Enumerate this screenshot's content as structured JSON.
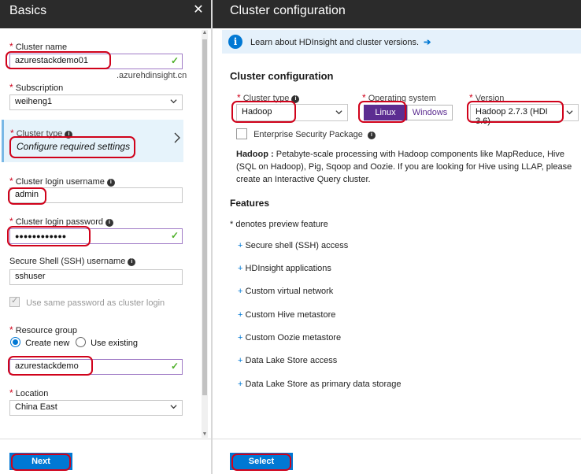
{
  "left": {
    "title": "Basics",
    "cluster_name": {
      "label": "Cluster name",
      "value": "azurestackdemo01",
      "suffix": ".azurehdinsight.cn"
    },
    "subscription": {
      "label": "Subscription",
      "value": "weiheng1"
    },
    "cluster_type": {
      "label": "Cluster type",
      "value": "Configure required settings"
    },
    "login_username": {
      "label": "Cluster login username",
      "value": "admin"
    },
    "login_password": {
      "label": "Cluster login password",
      "value": "●●●●●●●●●●●●"
    },
    "ssh_username": {
      "label": "Secure Shell (SSH) username",
      "value": "sshuser"
    },
    "same_password_label": "Use same password as cluster login",
    "resource_group": {
      "label": "Resource group",
      "create_new": "Create new",
      "use_existing": "Use existing",
      "value": "azurestackdemo"
    },
    "location": {
      "label": "Location",
      "value": "China East"
    },
    "next_label": "Next"
  },
  "right": {
    "title": "Cluster configuration",
    "info_text": "Learn about HDInsight and cluster versions.",
    "section_title": "Cluster configuration",
    "cluster_type": {
      "label": "Cluster type",
      "value": "Hadoop"
    },
    "operating_system": {
      "label": "Operating system",
      "options": [
        "Linux",
        "Windows"
      ],
      "selected": "Linux"
    },
    "version": {
      "label": "Version",
      "value": "Hadoop 2.7.3 (HDI 3.6)"
    },
    "esp_label": "Enterprise Security Package",
    "description_title": "Hadoop :",
    "description": "Petabyte-scale processing with Hadoop components like MapReduce, Hive (SQL on Hadoop), Pig, Sqoop and Oozie. If you are looking for Hive using LLAP, please create an Interactive Query cluster.",
    "features_title": "Features",
    "preview_note": "* denotes preview feature",
    "features": [
      "Secure shell (SSH) access",
      "HDInsight applications",
      "Custom virtual network",
      "Custom Hive metastore",
      "Custom Oozie metastore",
      "Data Lake Store access",
      "Data Lake Store as primary data storage"
    ],
    "select_label": "Select"
  },
  "colors": {
    "header_bg": "#2b2b2b",
    "accent_blue": "#0078d4",
    "accent_purple": "#5c2d91",
    "required_red": "#d0021b",
    "valid_green": "#4caf27",
    "annotation_red": "#d0021b"
  },
  "icons": [
    "close-icon",
    "chevron-down-icon",
    "chevron-right-icon",
    "checkmark-icon",
    "info-icon",
    "arrow-right-icon"
  ]
}
